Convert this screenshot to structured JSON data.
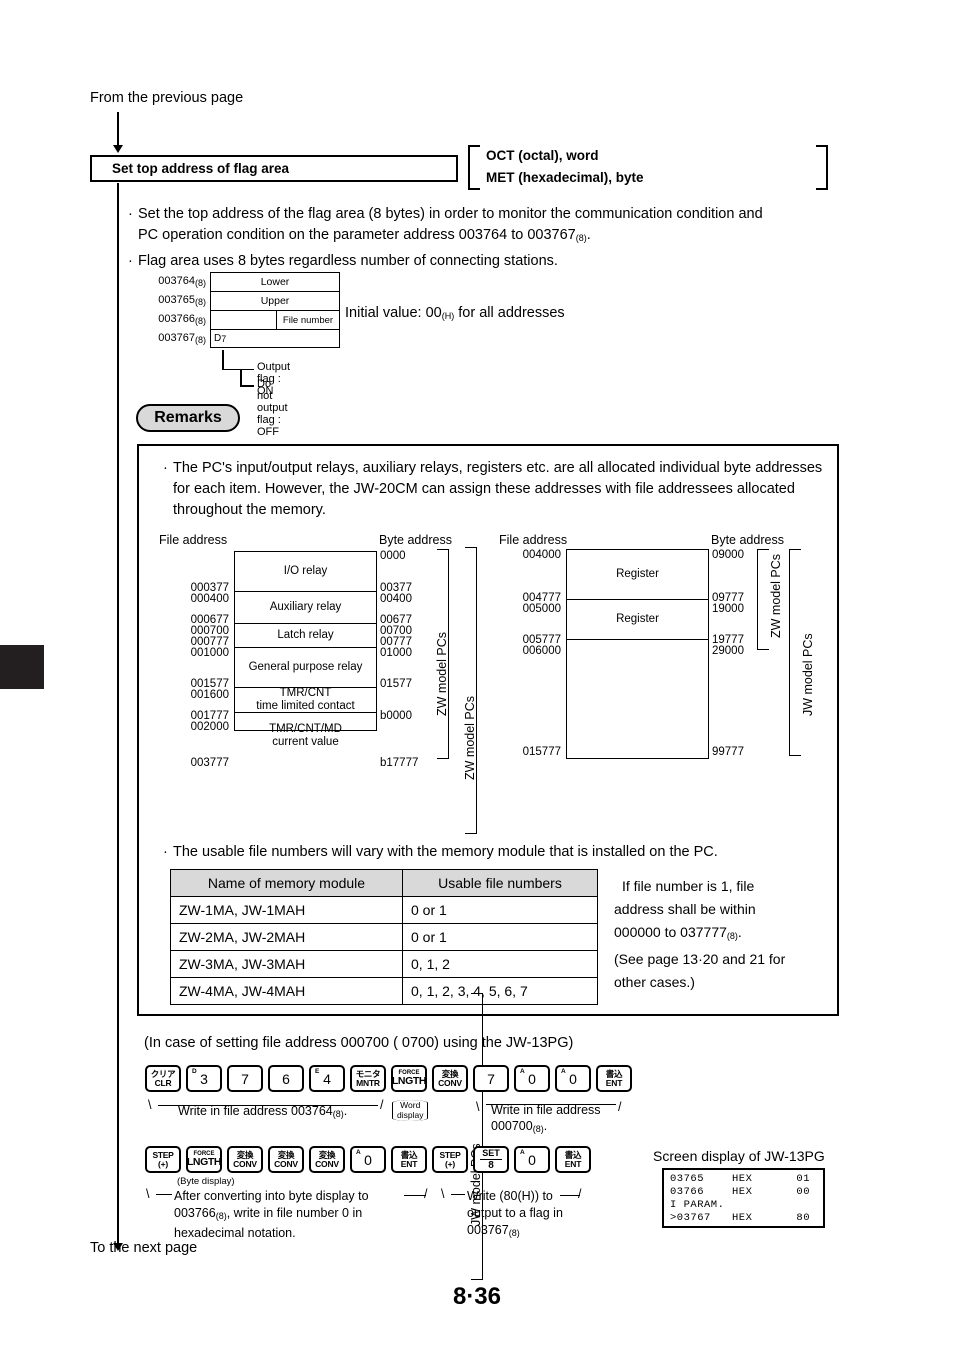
{
  "flow": {
    "from_previous": "From the previous page",
    "to_next": "To the next page"
  },
  "title_box": {
    "label": "Set top address of flag area"
  },
  "bracket_note": {
    "line1": "OCT (octal), word",
    "line2": "MET (hexadecimal), byte"
  },
  "bullets": [
    "Set the top address of the flag area (8 bytes) in order to monitor the communication condition and PC operation condition on the parameter address 003764 to 003767(8).",
    "Flag area uses 8 bytes regardless number of connecting stations."
  ],
  "bullets_parts": {
    "b1a": "Set the top address of the flag area (8 bytes) in order to monitor the communication condition and",
    "b1b": "PC operation condition on the parameter address 003764 to 003767",
    "b1sub": "(8)",
    "b1c": ".",
    "b2": "Flag area uses 8 bytes regardless number of connecting stations."
  },
  "address_map": {
    "rows": [
      {
        "address": "003764",
        "sub": "(8)",
        "content": "Lower",
        "kind": "full"
      },
      {
        "address": "003765",
        "sub": "(8)",
        "content": "Upper",
        "kind": "full"
      },
      {
        "address": "003766",
        "sub": "(8)",
        "content": "File number",
        "kind": "split"
      },
      {
        "address": "003767",
        "sub": "(8)",
        "content": "D7",
        "kind": "left"
      }
    ],
    "initial_value_pre": "Initial value: 00",
    "initial_value_sub": "(H)",
    "initial_value_post": " for all addresses",
    "leader_top": "Output flag : ON",
    "leader_bottom": "Do not output flag : OFF"
  },
  "remarks": {
    "badge": "Remarks",
    "text": "The PC's input/output relays, auxiliary relays, registers etc. are all allocated individual byte addresses for each item. However, the JW-20CM can assign these addresses with file addressees allocated throughout the memory.",
    "usable_note": "The usable file numbers will vary with the memory module that is installed on the PC."
  },
  "memory_map_left": {
    "header_file": "File address",
    "header_byte": "Byte address",
    "segments": [
      {
        "name": "I/O relay"
      },
      {
        "name": "Auxiliary relay"
      },
      {
        "name": "Latch relay"
      },
      {
        "name": "General purpose relay"
      },
      {
        "name": "TMR/CNT",
        "name2": "time limited contact"
      },
      {
        "name": "TMR/CNT/MD",
        "name2": "current value"
      }
    ],
    "file_addresses": [
      "000377",
      "000400",
      "000677",
      "000700",
      "000777",
      "001000",
      "001577",
      "001600",
      "001777",
      "002000",
      "003777"
    ],
    "byte_addresses": [
      "0000",
      "00377",
      "00400",
      "00677",
      "00700",
      "00777",
      "01000",
      "01577",
      "b0000",
      "b17777"
    ],
    "bracket_label": "ZW model PCs"
  },
  "memory_map_right": {
    "header_file": "File address",
    "header_byte": "Byte address",
    "segments": [
      {
        "name": "Register"
      },
      {
        "name": "Register"
      },
      {
        "name": ""
      }
    ],
    "file_addresses": [
      "004000",
      "004777",
      "005000",
      "005777",
      "006000",
      "015777"
    ],
    "byte_addresses": [
      "09000",
      "09777",
      "19000",
      "19777",
      "29000",
      "99777"
    ],
    "bracket_label_zw": "ZW model PCs",
    "bracket_label_jw": "JW model PCs"
  },
  "mid_brackets": {
    "zw": "ZW model PCs",
    "jw": "JW model PCs"
  },
  "usable_table": {
    "headers": [
      "Name of memory module",
      "Usable file numbers"
    ],
    "rows": [
      [
        "ZW-1MA, JW-1MAH",
        "0 or 1"
      ],
      [
        "ZW-2MA, JW-2MAH",
        "0 or 1"
      ],
      [
        "ZW-3MA, JW-3MAH",
        "0, 1, 2"
      ],
      [
        "ZW-4MA, JW-4MAH",
        "0, 1, 2, 3, 4, 5, 6, 7"
      ]
    ]
  },
  "side_note": {
    "l1": "If file number is 1, file",
    "l2": "address shall be within",
    "l3a": "000000 to 037777",
    "l3sub": "(8)",
    "l3b": ".",
    "l4": "(See page 13·20 and 21 for",
    "l5": "other cases.)"
  },
  "keypad_section": {
    "case_line": "(In case of setting file address 000700 (  0700) using the JW-13PG)",
    "row1": [
      {
        "type": "two",
        "jp": "クリア",
        "en": "CLR"
      },
      {
        "type": "num",
        "big": "3",
        "sup": "D"
      },
      {
        "type": "num",
        "big": "7",
        "sup": ""
      },
      {
        "type": "num",
        "big": "6",
        "sup": ""
      },
      {
        "type": "num",
        "big": "4",
        "sup": "E"
      },
      {
        "type": "two",
        "jp": "モニタ",
        "en": "MNTR"
      },
      {
        "type": "lngth",
        "tiny": "FORCE",
        "lng": "LNGTH"
      },
      {
        "type": "two",
        "jp": "変換",
        "en": "CONV"
      },
      {
        "type": "num",
        "big": "7",
        "sup": ""
      },
      {
        "type": "num",
        "big": "0",
        "sup": "A"
      },
      {
        "type": "num",
        "big": "0",
        "sup": "A"
      },
      {
        "type": "two",
        "jp": "書込",
        "en": "ENT"
      }
    ],
    "row2": [
      {
        "type": "two",
        "jp": "STEP",
        "en": "(+)"
      },
      {
        "type": "lngth",
        "tiny": "FORCE",
        "lng": "LNGTH"
      },
      {
        "type": "two",
        "jp": "変換",
        "en": "CONV"
      },
      {
        "type": "two",
        "jp": "変換",
        "en": "CONV"
      },
      {
        "type": "two",
        "jp": "変換",
        "en": "CONV"
      },
      {
        "type": "num",
        "big": "0",
        "sup": "A"
      },
      {
        "type": "two",
        "jp": "書込",
        "en": "ENT"
      },
      {
        "type": "two",
        "jp": "STEP",
        "en": "(+)"
      },
      {
        "type": "set",
        "settop": "SET",
        "setnum": "8"
      },
      {
        "type": "num",
        "big": "0",
        "sup": "A"
      },
      {
        "type": "two",
        "jp": "書込",
        "en": "ENT"
      }
    ],
    "ann_row1_left_a": "Write in file address 003764",
    "ann_row1_left_sub": "(8)",
    "ann_row1_left_b": ".",
    "word_display_l1": "Word",
    "word_display_l2": "display",
    "ann_row1_right_l1": "Write in file address",
    "ann_row1_right_l2a": "000700",
    "ann_row1_right_l2sub": "(8)",
    "ann_row1_right_l2b": ".",
    "byte_display": "(Byte display)",
    "ann_row2_left_l1": "After converting into byte display to",
    "ann_row2_left_l2a": "003766",
    "ann_row2_left_l2sub": "(8)",
    "ann_row2_left_l2b": ", write in file number 0 in",
    "ann_row2_left_l3": "hexadecimal notation.",
    "ann_row2_right_l1": "Write (80(H)) to",
    "ann_row2_right_l2": "output to a flag in",
    "ann_row2_right_l3a": "003767",
    "ann_row2_right_l3sub": "(8)"
  },
  "screen_display": {
    "title": "Screen display of JW-13PG",
    "lines": [
      {
        "a": " 03765",
        "b": "HEX",
        "c": "01"
      },
      {
        "a": " 03766",
        "b": "HEX",
        "c": "00"
      },
      {
        "a": "I PARAM.",
        "b": "",
        "c": ""
      },
      {
        "a": ">03767",
        "b": "HEX",
        "c": "80"
      }
    ]
  },
  "page_number": "8·36"
}
